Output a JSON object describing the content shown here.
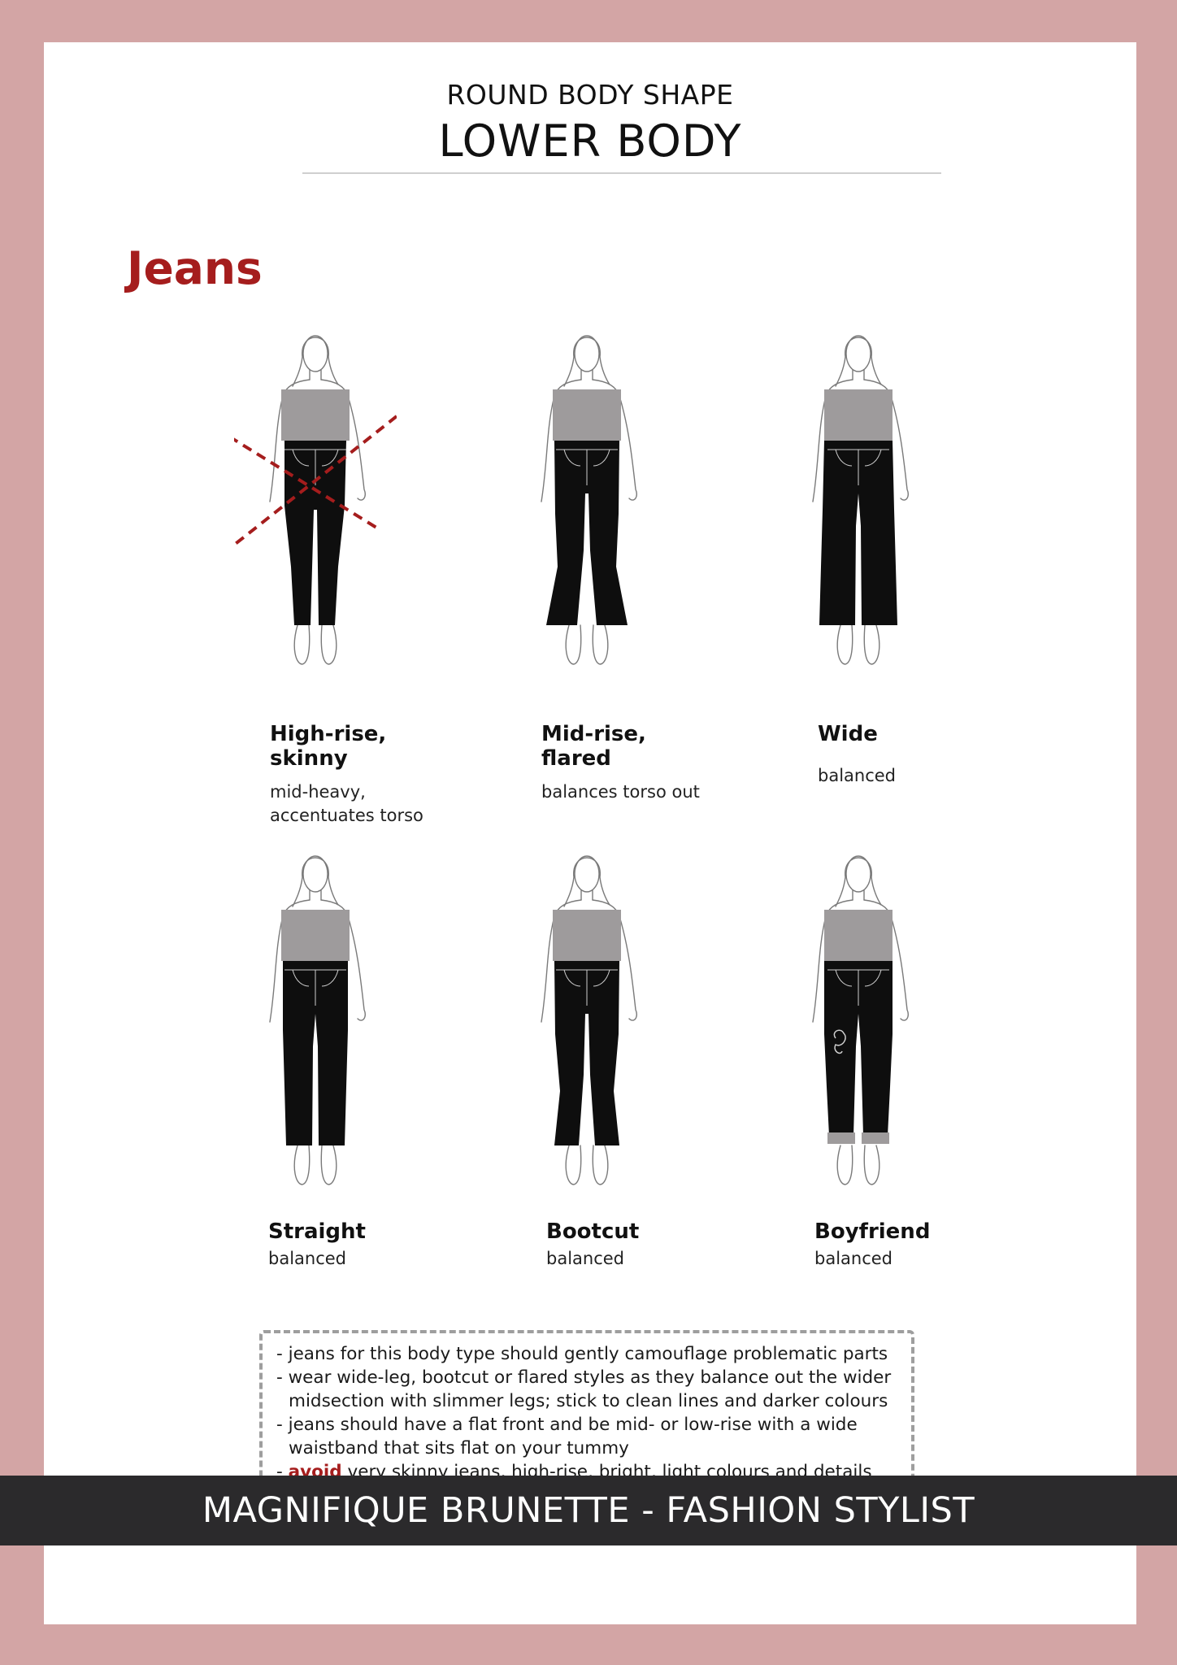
{
  "header": {
    "subtitle": "ROUND BODY SHAPE",
    "title": "LOWER BODY"
  },
  "section": {
    "title": "Jeans"
  },
  "styles": [
    {
      "title": "High-rise,\nskinny",
      "desc": "mid-heavy,\naccentuates torso",
      "crossed": true,
      "leg": "skinny"
    },
    {
      "title": "Mid-rise,\nflared",
      "desc": "balances torso out",
      "crossed": false,
      "leg": "flared"
    },
    {
      "title": "Wide",
      "desc": "balanced",
      "crossed": false,
      "leg": "wide"
    },
    {
      "title": "Straight",
      "desc": "balanced",
      "crossed": false,
      "leg": "straight"
    },
    {
      "title": "Bootcut",
      "desc": "balanced",
      "crossed": false,
      "leg": "bootcut"
    },
    {
      "title": "Boyfriend",
      "desc": "balanced",
      "crossed": false,
      "leg": "boyfriend"
    }
  ],
  "tips": {
    "line1": "- jeans for this body type should gently camouflage problematic parts",
    "line2": "- wear wide-leg, bootcut or flared styles as they balance out the wider",
    "line3": "midsection with slimmer legs; stick to clean lines and darker colours",
    "line4": "- jeans should have a flat front and be mid- or low-rise with a wide",
    "line5": "waistband that sits flat on your tummy",
    "line6_dash": "- ",
    "line6_avoid": "avoid",
    "line6_rest": " very skinny jeans, high-rise, bright, light colours and details"
  },
  "footer": {
    "text": "MAGNIFIQUE BRUNETTE - FASHION STYLIST"
  },
  "colors": {
    "frame": "#d3a5a5",
    "accent": "#a51d1d",
    "footer_bg": "#2b2a2c",
    "top_garment": "#9e9b9c",
    "jeans": "#0e0e0e"
  }
}
